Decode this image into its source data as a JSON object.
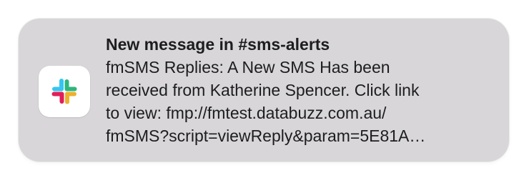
{
  "notification": {
    "app_icon": "slack-logo-icon",
    "title": "New message in #sms-alerts",
    "body_lines": [
      "fmSMS Replies: A New SMS Has been",
      "received from Katherine Spencer. Click link",
      "to view: fmp://fmtest.databuzz.com.au/",
      "fmSMS?script=viewReply&param=5E81A…"
    ]
  },
  "colors": {
    "background": "#d8d6d8",
    "text": "#1d1d1f",
    "slack_blue": "#36c5f0",
    "slack_green": "#2eb67d",
    "slack_yellow": "#ecb22e",
    "slack_red": "#e01e5a"
  }
}
